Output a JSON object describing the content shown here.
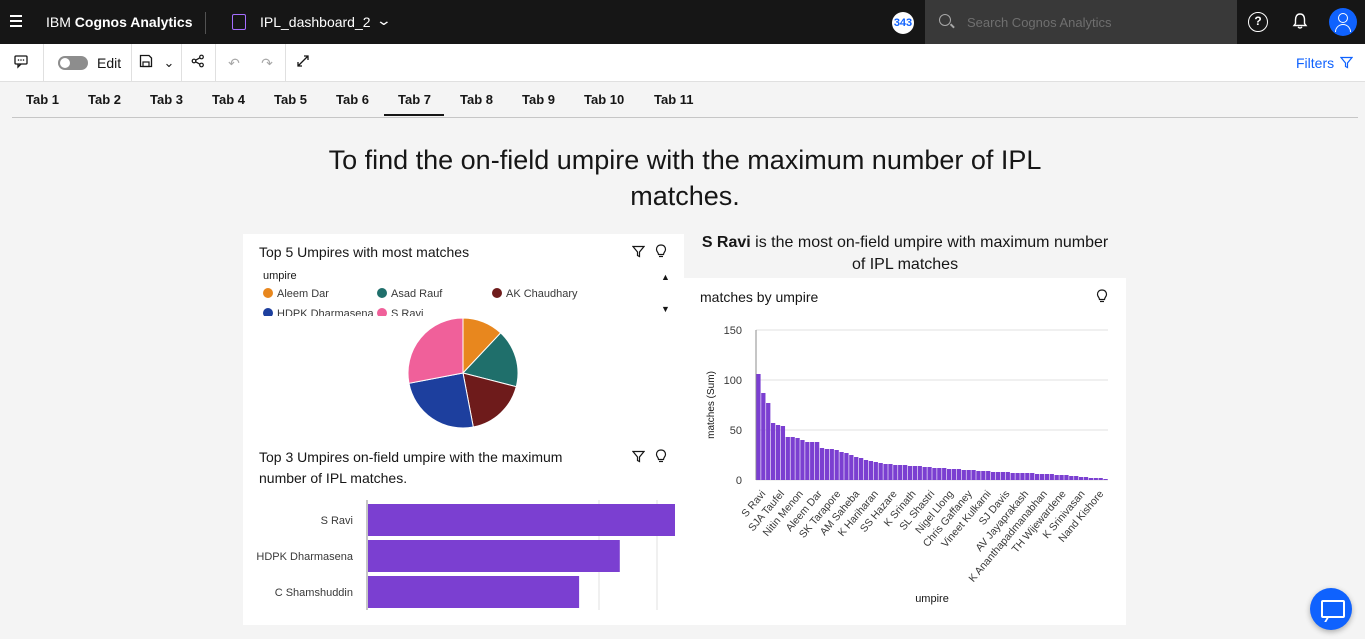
{
  "app": {
    "brand_prefix": "IBM ",
    "brand_bold": "Cognos Analytics",
    "dashboard_name": "IPL_dashboard_2",
    "badge": "343",
    "search_placeholder": "Search Cognos Analytics",
    "accent": "#0f62fe"
  },
  "toolbar": {
    "edit_label": "Edit",
    "filters_label": "Filters"
  },
  "tabs": [
    "Tab 1",
    "Tab 2",
    "Tab 3",
    "Tab 4",
    "Tab 5",
    "Tab 6",
    "Tab 7",
    "Tab 8",
    "Tab 9",
    "Tab 10",
    "Tab 11"
  ],
  "active_tab": "Tab 7",
  "page": {
    "title": "To find the on-field umpire with the maximum number of IPL matches.",
    "highlight_name": "S Ravi",
    "highlight_rest": " is the most on-field umpire with maximum number of IPL matches"
  },
  "pie_panel": {
    "title": "Top 5 Umpires with most matches",
    "legend_title": "umpire"
  },
  "bar_panel": {
    "title_line1": "Top 3 Umpires on-field umpire with the maximum",
    "title_line2": "number of IPL matches."
  },
  "col_panel": {
    "title": "matches by umpire"
  },
  "chart_data": [
    {
      "type": "pie",
      "title": "Top 5 Umpires with most matches",
      "legend_title": "umpire",
      "categories": [
        "Aleem Dar",
        "Asad Rauf",
        "AK Chaudhary",
        "HDPK Dharmasena",
        "S Ravi"
      ],
      "values": [
        12,
        17,
        18,
        25,
        28
      ],
      "colors": [
        "#e8871e",
        "#1f6f6b",
        "#6e1b1b",
        "#1d3f9e",
        "#f0609a"
      ]
    },
    {
      "type": "bar",
      "orientation": "horizontal",
      "categories": [
        "S Ravi",
        "HDPK Dharmasena",
        "C Shamshuddin"
      ],
      "values": [
        106,
        87,
        73
      ],
      "color": "#7b3fd1"
    },
    {
      "type": "bar",
      "title": "matches by umpire",
      "xlabel": "umpire",
      "ylabel": "matches (Sum)",
      "ylim": [
        0,
        150
      ],
      "yticks": [
        0,
        50,
        100,
        150
      ],
      "grid": true,
      "color": "#7b3fd1",
      "tick_labels": [
        "S Ravi",
        "SJA Taufel",
        "Nitin Menon",
        "Aleem Dar",
        "SK Tarapore",
        "AM Saheba",
        "K Hariharan",
        "SS Hazare",
        "K Srinath",
        "SL Shastri",
        "Nigel Llong",
        "Chris Gaffaney",
        "Vineet Kulkarni",
        "SJ Davis",
        "AV Jayaprakash",
        "K Ananthapadmanabhan",
        "TH Wijewardene",
        "K Srinivasan",
        "Nand Kishore"
      ],
      "values": [
        106,
        87,
        77,
        57,
        55,
        54,
        43,
        43,
        42,
        40,
        38,
        38,
        38,
        32,
        31,
        31,
        30,
        28,
        27,
        25,
        23,
        22,
        20,
        19,
        18,
        17,
        16,
        16,
        15,
        15,
        15,
        14,
        14,
        14,
        13,
        13,
        12,
        12,
        12,
        11,
        11,
        11,
        10,
        10,
        10,
        9,
        9,
        9,
        8,
        8,
        8,
        8,
        7,
        7,
        7,
        7,
        7,
        6,
        6,
        6,
        6,
        5,
        5,
        5,
        4,
        4,
        3,
        3,
        2,
        2,
        2,
        1
      ]
    }
  ]
}
